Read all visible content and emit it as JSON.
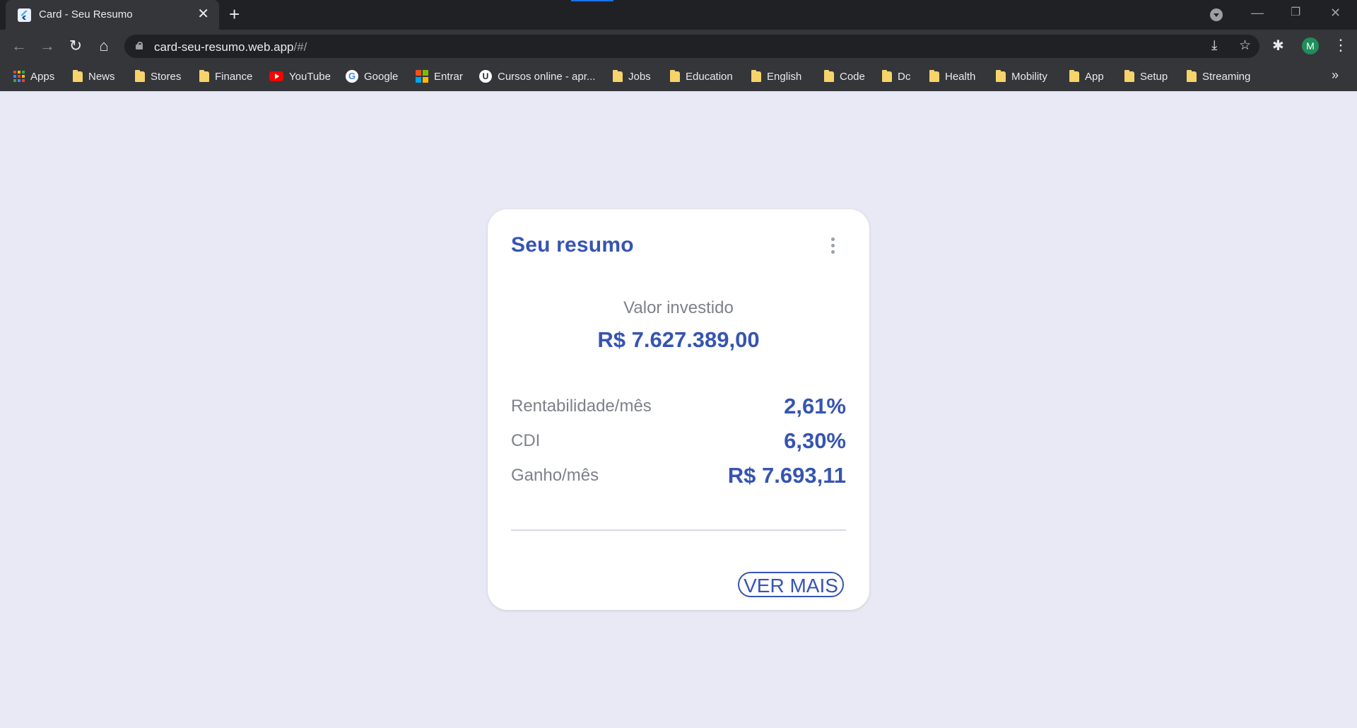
{
  "browser": {
    "tab_title": "Card - Seu Resumo",
    "tab_close": "✕",
    "new_tab": "+",
    "url_host": "card-seu-resumo.web.app",
    "url_path": "/#/",
    "avatar_letter": "M",
    "window_minimize": "—",
    "window_restore": "❐",
    "window_close": "✕",
    "bookmarks_overflow": "»"
  },
  "bookmarks": [
    {
      "label": "Apps",
      "icon": "apps-grid-icon"
    },
    {
      "label": "News",
      "icon": "folder-icon"
    },
    {
      "label": "Stores",
      "icon": "folder-icon"
    },
    {
      "label": "Finance",
      "icon": "folder-icon"
    },
    {
      "label": "YouTube",
      "icon": "youtube-icon"
    },
    {
      "label": "Google",
      "icon": "google-icon"
    },
    {
      "label": "Entrar",
      "icon": "microsoft-icon"
    },
    {
      "label": "Cursos online - apr...",
      "icon": "udemy-icon"
    },
    {
      "label": "Jobs",
      "icon": "folder-icon"
    },
    {
      "label": "Education",
      "icon": "folder-icon"
    },
    {
      "label": "English",
      "icon": "folder-icon"
    },
    {
      "label": "Code",
      "icon": "folder-icon"
    },
    {
      "label": "Dc",
      "icon": "folder-icon"
    },
    {
      "label": "Health",
      "icon": "folder-icon"
    },
    {
      "label": "Mobility",
      "icon": "folder-icon"
    },
    {
      "label": "App",
      "icon": "folder-icon"
    },
    {
      "label": "Setup",
      "icon": "folder-icon"
    },
    {
      "label": "Streaming",
      "icon": "folder-icon"
    }
  ],
  "card": {
    "title": "Seu resumo",
    "invested_label": "Valor investido",
    "invested_value": "R$ 7.627.389,00",
    "rows": [
      {
        "label": "Rentabilidade/mês",
        "value": "2,61%"
      },
      {
        "label": "CDI",
        "value": "6,30%"
      },
      {
        "label": "Ganho/mês",
        "value": "R$ 7.693,11"
      }
    ],
    "button_label": "VER MAIS"
  },
  "colors": {
    "accent": "#3654b1",
    "muted_text": "#7e8189",
    "page_background": "#e8e9f5",
    "card_background": "#ffffff"
  }
}
